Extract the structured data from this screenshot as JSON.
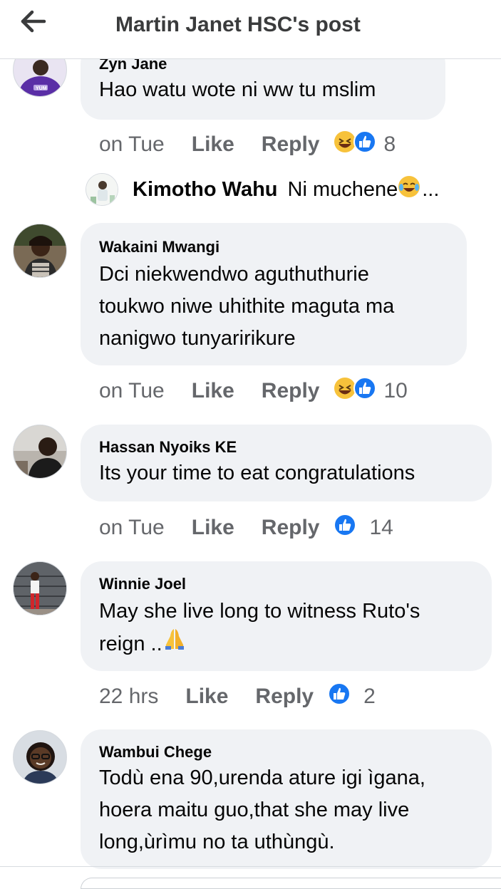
{
  "header": {
    "title": "Martin Janet HSC's post",
    "back_icon": "arrow-left-icon"
  },
  "comments": [
    {
      "author": "Zyn Jane",
      "text": "Hao watu wote ni ww tu mslim",
      "time": "on Tue",
      "like_label": "Like",
      "reply_label": "Reply",
      "reactions": [
        "laughing-emoji-icon",
        "like-reaction-icon"
      ],
      "reaction_count": "8"
    },
    {
      "author": "Wakaini Mwangi",
      "text_lines": [
        "Dci niekwendwo aguthuthurie",
        "toukwo niwe uhithite maguta ma",
        "nanigwo tunyaririkure"
      ],
      "time": "on Tue",
      "like_label": "Like",
      "reply_label": "Reply",
      "reactions": [
        "laughing-emoji-icon",
        "like-reaction-icon"
      ],
      "reaction_count": "10"
    },
    {
      "author": "Hassan Nyoiks KE",
      "text": "Its your time to eat congratulations",
      "time": "on Tue",
      "like_label": "Like",
      "reply_label": "Reply",
      "reactions": [
        "like-reaction-icon"
      ],
      "reaction_count": "14"
    },
    {
      "author": "Winnie Joel",
      "text_lines": [
        "May she live long to witness Ruto's",
        "reign .."
      ],
      "time": "22 hrs",
      "like_label": "Like",
      "reply_label": "Reply",
      "reactions": [
        "like-reaction-icon"
      ],
      "reaction_count": "2"
    },
    {
      "author": "Wambui Chege",
      "text_lines": [
        "Todù ena 90,urenda ature igi ìgana,",
        "hoera maitu guo,that she may live",
        "long,ùrìmu no ta uthùngù."
      ]
    }
  ],
  "reply_preview": {
    "author": "Kimotho Wahu",
    "text": "Ni muchene",
    "ellipsis": "..."
  },
  "colors": {
    "bubble": "#f0f2f5",
    "meta_text": "#65676b",
    "like_blue": "#1877f2",
    "emoji_yellow": "#f7c23b"
  }
}
